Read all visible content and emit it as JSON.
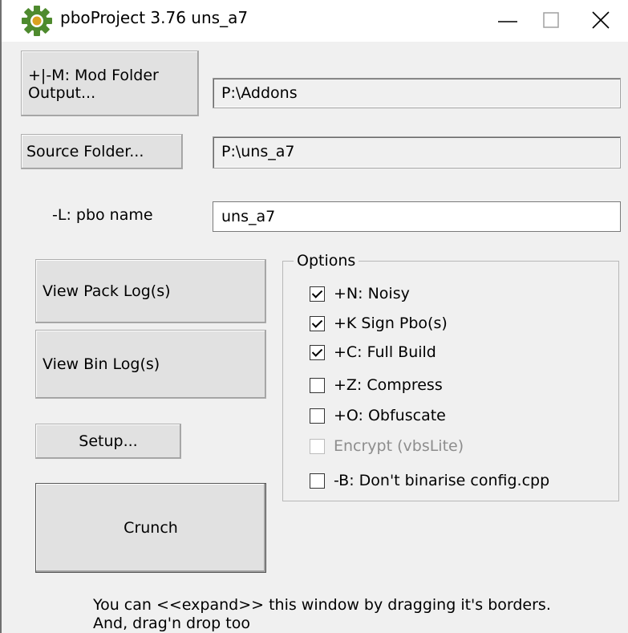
{
  "window": {
    "title": "pboProject 3.76 uns_a7",
    "icon": "gear-icon"
  },
  "paths": {
    "mod_folder_button": "+|-M: Mod Folder\nOutput...",
    "mod_folder_value": "P:\\Addons",
    "source_folder_button": "Source Folder...",
    "source_folder_value": "P:\\uns_a7",
    "pbo_name_label": "-L: pbo name",
    "pbo_name_value": "uns_a7"
  },
  "buttons": {
    "view_pack_log": "View Pack Log(s)",
    "view_bin_log": "View Bin Log(s)",
    "setup": "Setup...",
    "crunch": "Crunch"
  },
  "options": {
    "label": "Options",
    "items": [
      {
        "label": "+N: Noisy",
        "checked": true,
        "enabled": true
      },
      {
        "label": "+K Sign Pbo(s)",
        "checked": true,
        "enabled": true
      },
      {
        "label": "+C: Full Build",
        "checked": true,
        "enabled": true
      },
      {
        "label": "+Z: Compress",
        "checked": false,
        "enabled": true
      },
      {
        "label": "+O: Obfuscate",
        "checked": false,
        "enabled": true
      },
      {
        "label": "Encrypt (vbsLite)",
        "checked": false,
        "enabled": false
      },
      {
        "label": "-B: Don't binarise config.cpp",
        "checked": false,
        "enabled": true
      }
    ]
  },
  "footer": {
    "line1": "You can <<expand>> this window by dragging it's borders.",
    "line2": "And, drag'n drop too"
  },
  "colors": {
    "window_bg": "#f0f0f0",
    "titlebar_bg": "#ffffff",
    "icon_green": "#4e8a2e",
    "disabled_text": "#8d8d8d"
  }
}
